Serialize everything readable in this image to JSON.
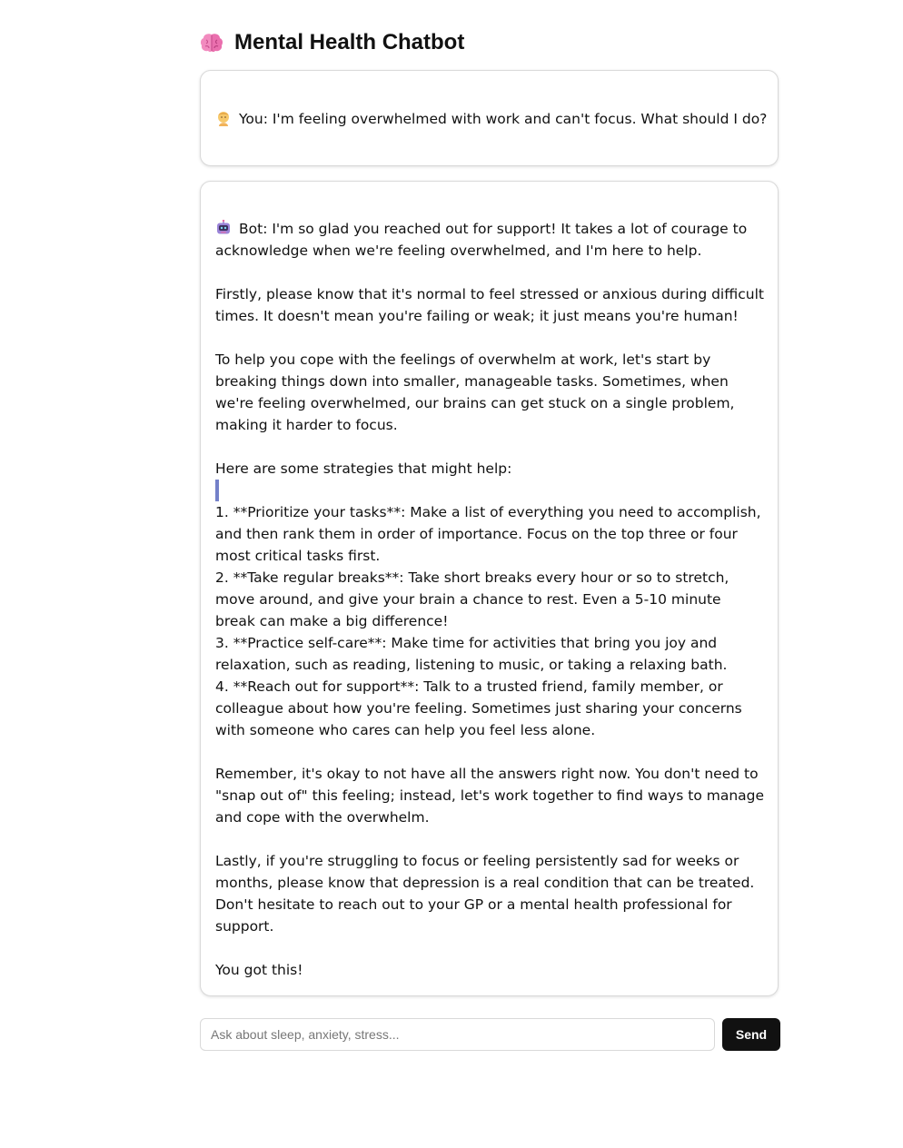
{
  "app": {
    "title": "Mental Health Chatbot",
    "title_icon": "brain-icon"
  },
  "conversation": {
    "user_message": {
      "icon": "person-icon",
      "text": "You: I'm feeling overwhelmed with work and can't focus. What should I do?"
    },
    "bot_message": {
      "icon": "robot-icon",
      "intro": "Bot: I'm so glad you reached out for support! It takes a lot of courage to acknowledge when we're feeling overwhelmed, and I'm here to help.\n\nFirstly, please know that it's normal to feel stressed or anxious during difficult times. It doesn't mean you're failing or weak; it just means you're human!\n\nTo help you cope with the feelings of overwhelm at work, let's start by breaking things down into smaller, manageable tasks. Sometimes, when we're feeling overwhelmed, our brains can get stuck on a single problem, making it harder to focus.\n\nHere are some strategies that might help:",
      "body": "1. **Prioritize your tasks**: Make a list of everything you need to accomplish, and then rank them in order of importance. Focus on the top three or four most critical tasks first.\n2. **Take regular breaks**: Take short breaks every hour or so to stretch, move around, and give your brain a chance to rest. Even a 5-10 minute break can make a big difference!\n3. **Practice self-care**: Make time for activities that bring you joy and relaxation, such as reading, listening to music, or taking a relaxing bath.\n4. **Reach out for support**: Talk to a trusted friend, family member, or colleague about how you're feeling. Sometimes just sharing your concerns with someone who cares can help you feel less alone.\n\nRemember, it's okay to not have all the answers right now. You don't need to \"snap out of\" this feeling; instead, let's work together to find ways to manage and cope with the overwhelm.\n\nLastly, if you're struggling to focus or feeling persistently sad for weeks or months, please know that depression is a real condition that can be treated. Don't hesitate to reach out to your GP or a mental health professional for support.\n\nYou got this!"
    }
  },
  "composer": {
    "value": "",
    "placeholder": "Ask about sleep, anxiety, stress...",
    "send_label": "Send"
  },
  "colors": {
    "accent": "#111111",
    "border": "#d9d9d9",
    "caret": "#5c6bc0"
  }
}
